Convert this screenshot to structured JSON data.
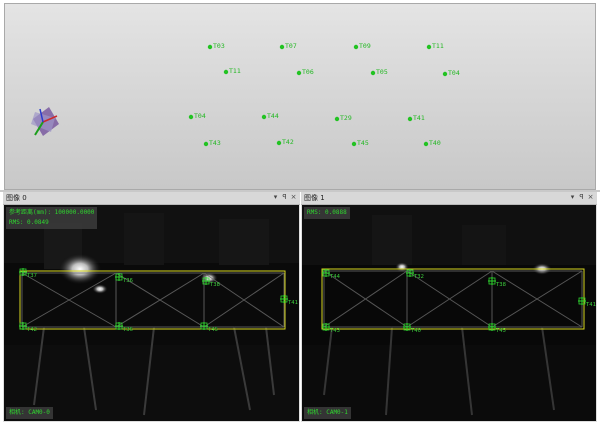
{
  "scene": {
    "targets": [
      {
        "id": "T03"
      },
      {
        "id": "T07"
      },
      {
        "id": "T09"
      },
      {
        "id": "T11"
      },
      {
        "id": "T11"
      },
      {
        "id": "T06"
      },
      {
        "id": "T05"
      },
      {
        "id": "T04"
      },
      {
        "id": "T04"
      },
      {
        "id": "T44"
      },
      {
        "id": "T29"
      },
      {
        "id": "T41"
      },
      {
        "id": "T43"
      },
      {
        "id": "T42"
      },
      {
        "id": "T45"
      },
      {
        "id": "T40"
      }
    ]
  },
  "panes": [
    {
      "title": "图像 0",
      "info_lines": [
        "参考距离(mm): 100000.0000",
        "RMS: 0.0849"
      ],
      "footer": "相机: CAM0-0",
      "points": [
        "T37",
        "T36",
        "T38",
        "T41",
        "T42",
        "T36",
        "T45"
      ]
    },
    {
      "title": "图像 1",
      "info_lines": [
        "RMS: 0.0888"
      ],
      "footer": "相机: CAM0-1",
      "points": [
        "T44",
        "T32",
        "T38",
        "T41",
        "T43",
        "T40",
        "T45"
      ]
    }
  ],
  "pane_controls": [
    "▾",
    "ꟼ",
    "×"
  ],
  "colors": {
    "target": "#22c322",
    "frame": "#d8d820",
    "marker": "#2fd62f",
    "info_text": "#2fd62f"
  }
}
